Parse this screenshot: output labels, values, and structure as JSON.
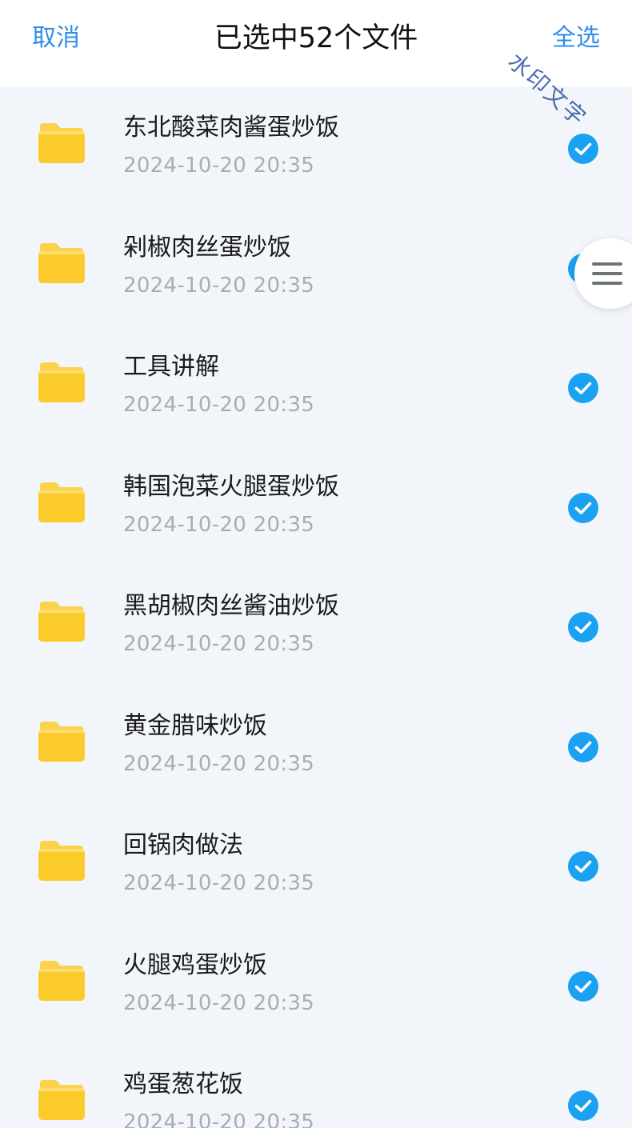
{
  "header": {
    "cancel_label": "取消",
    "title": "已选中52个文件",
    "select_all_label": "全选"
  },
  "watermark_text": "水印文字",
  "colors": {
    "accent": "#2f8ee8",
    "check": "#1ba1f2",
    "folder": "#fbcb2c",
    "background": "#f2f6fa"
  },
  "files": [
    {
      "name": "东北酸菜肉酱蛋炒饭",
      "date": "2024-10-20  20:35",
      "selected": true,
      "icon": "folder-icon"
    },
    {
      "name": "剁椒肉丝蛋炒饭",
      "date": "2024-10-20  20:35",
      "selected": true,
      "icon": "folder-icon"
    },
    {
      "name": "工具讲解",
      "date": "2024-10-20  20:35",
      "selected": true,
      "icon": "folder-icon"
    },
    {
      "name": "韩国泡菜火腿蛋炒饭",
      "date": "2024-10-20  20:35",
      "selected": true,
      "icon": "folder-icon"
    },
    {
      "name": "黑胡椒肉丝酱油炒饭",
      "date": "2024-10-20  20:35",
      "selected": true,
      "icon": "folder-icon"
    },
    {
      "name": "黄金腊味炒饭",
      "date": "2024-10-20  20:35",
      "selected": true,
      "icon": "folder-icon"
    },
    {
      "name": "回锅肉做法",
      "date": "2024-10-20  20:35",
      "selected": true,
      "icon": "folder-icon"
    },
    {
      "name": "火腿鸡蛋炒饭",
      "date": "2024-10-20  20:35",
      "selected": true,
      "icon": "folder-icon"
    },
    {
      "name": "鸡蛋葱花饭",
      "date": "2024-10-20  20:35",
      "selected": true,
      "icon": "folder-icon"
    }
  ],
  "floating_button": {
    "icon": "menu-icon"
  }
}
